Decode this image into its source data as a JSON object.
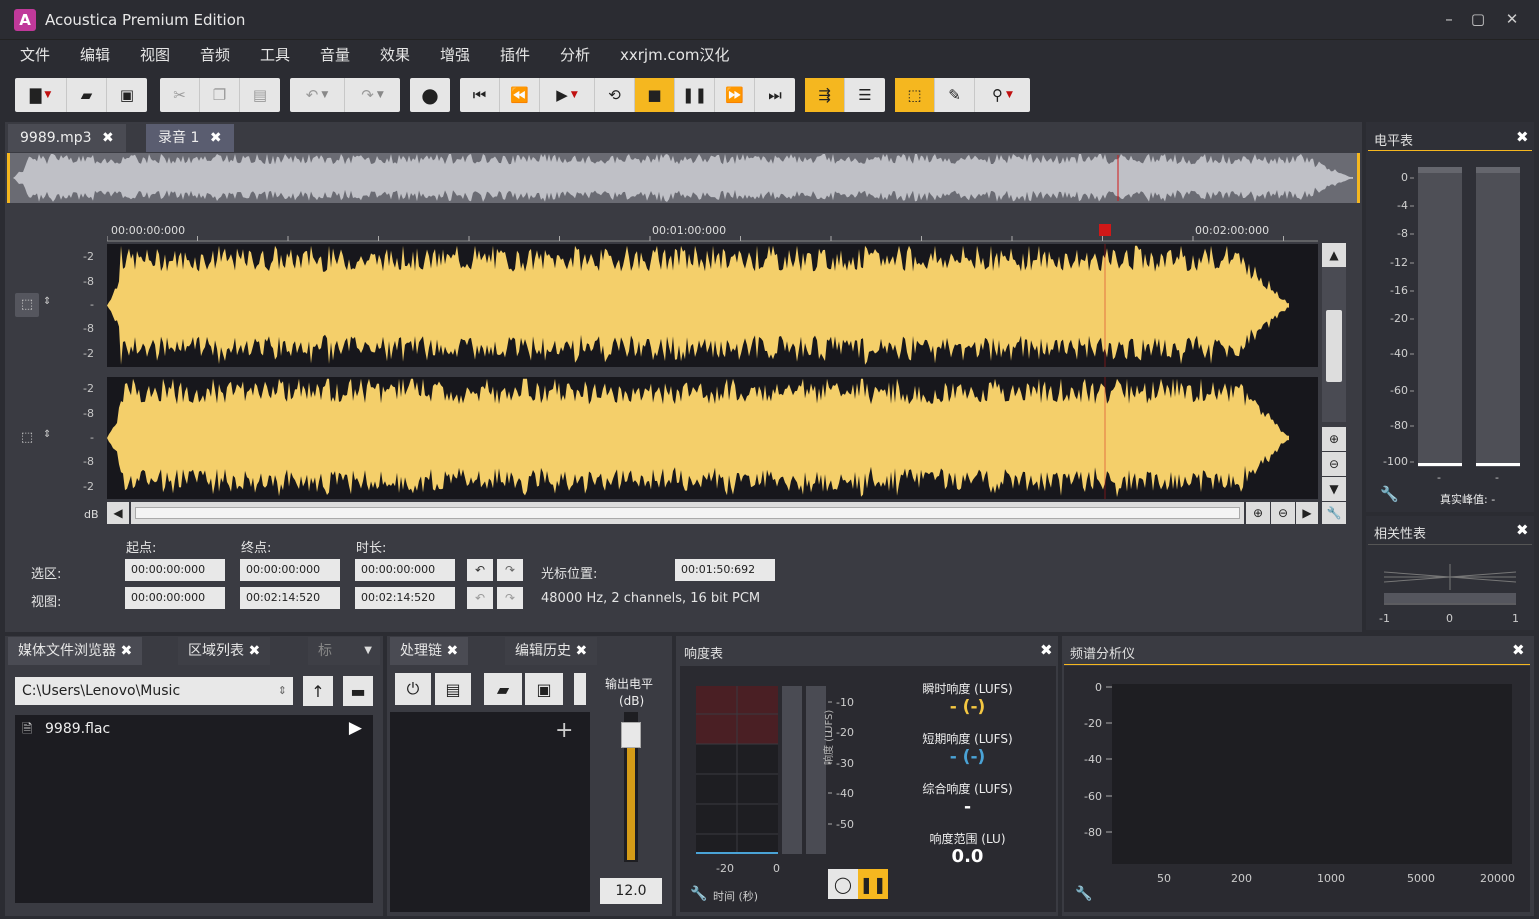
{
  "window": {
    "title": "Acoustica Premium Edition",
    "logo": "A",
    "min": "–",
    "max": "▢",
    "close": "✕"
  },
  "menu": [
    "文件",
    "编辑",
    "视图",
    "音频",
    "工具",
    "音量",
    "效果",
    "增强",
    "插件",
    "分析",
    "xxrjm.com汉化"
  ],
  "doc_tabs": [
    {
      "label": "9989.mp3",
      "close": "✖"
    },
    {
      "label": "录音 1",
      "close": "✖"
    }
  ],
  "timeline": {
    "ticks": [
      "00:00:00:000",
      "00:01:00:000",
      "00:02:00:000"
    ]
  },
  "db_labels": {
    "ch1": [
      "-2",
      "-8",
      "-",
      "-8",
      "-2"
    ],
    "ch2": [
      "-2",
      "-8",
      "-",
      "-8",
      "-2"
    ],
    "unit": "dB"
  },
  "selection": {
    "col_start": "起点:",
    "col_end": "终点:",
    "col_length": "时长:",
    "row_selection": "选区:",
    "row_view": "视图:",
    "sel_start": "00:00:00:000",
    "sel_end": "00:00:00:000",
    "sel_length": "00:00:00:000",
    "view_start": "00:00:00:000",
    "view_end": "00:02:14:520",
    "view_length": "00:02:14:520",
    "cursor_label": "光标位置:",
    "cursor_value": "00:01:50:692",
    "format": "48000 Hz, 2 channels, 16 bit PCM"
  },
  "level_meter": {
    "title": "电平表",
    "close": "✖",
    "scale": [
      "0",
      "-4",
      "-8",
      "-12",
      "-16",
      "-20",
      "-40",
      "-60",
      "-80",
      "-100"
    ],
    "peak_left": "-",
    "peak_right": "-",
    "true_peak_label": "真实峰值: -"
  },
  "correlation": {
    "title": "相关性表",
    "close": "✖",
    "scale": [
      "-1",
      "0",
      "1"
    ]
  },
  "media_browser": {
    "tabs": [
      {
        "label": "媒体文件浏览器",
        "close": "✖"
      },
      {
        "label": "区域列表",
        "close": "✖"
      },
      {
        "label": "标",
        "close": ""
      }
    ],
    "path": "C:\\Users\\Lenovo\\Music",
    "files": [
      "9989.flac"
    ]
  },
  "process_chain": {
    "tabs": [
      {
        "label": "处理链",
        "close": "✖"
      },
      {
        "label": "编辑历史",
        "close": "✖"
      }
    ],
    "output_label": "输出电平",
    "output_unit": "(dB)",
    "output_value": "12.0",
    "output_level": 0.85,
    "add": "+"
  },
  "loudness": {
    "title": "响度表",
    "close": "✖",
    "scale": [
      "-10",
      "-20",
      "-30",
      "-40",
      "-50"
    ],
    "axis_label": "响度 (LUFS)",
    "x_ticks": [
      "-20",
      "0"
    ],
    "x_label": "时间 (秒)",
    "momentary_label": "瞬时响度 (LUFS)",
    "momentary_value": "- (-)",
    "short_label": "短期响度 (LUFS)",
    "short_value": "- (-)",
    "integrated_label": "综合响度 (LUFS)",
    "integrated_value": "-",
    "range_label": "响度范围 (LU)",
    "range_value": "0.0"
  },
  "spectrum": {
    "title": "频谱分析仪",
    "close": "✖",
    "y_scale": [
      "0",
      "-20",
      "-40",
      "-60",
      "-80"
    ],
    "x_scale": [
      "50",
      "200",
      "1000",
      "5000",
      "20000"
    ]
  },
  "colors": {
    "accent": "#f5b71f",
    "wave": "#f4cf6a",
    "marker": "#d01818",
    "bg": "#2b2c32"
  }
}
